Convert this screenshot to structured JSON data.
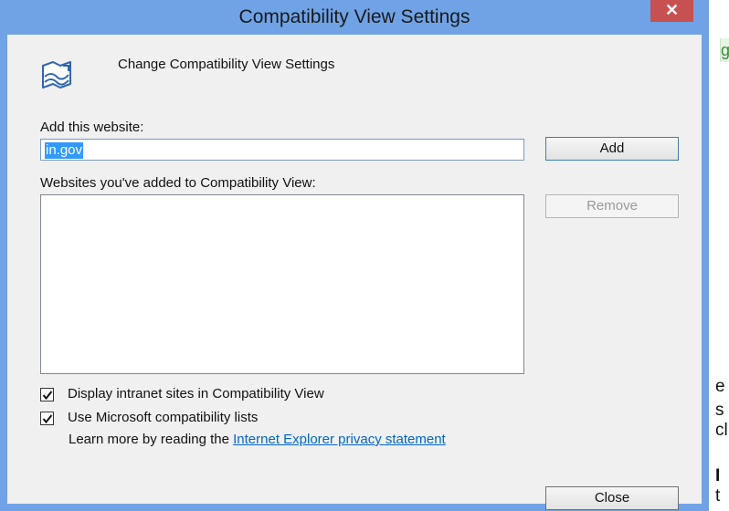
{
  "window": {
    "title": "Compatibility View Settings",
    "close_glyph": "✕",
    "title_bar_color": "#6fa3e6",
    "close_button_color": "#c75050"
  },
  "header": {
    "icon": "compatibility-view-icon",
    "text": "Change Compatibility View Settings"
  },
  "add_website": {
    "label": "Add this website:",
    "value": "in.gov",
    "button_label": "Add"
  },
  "websites_list": {
    "label": "Websites you've added to Compatibility View:",
    "items": [],
    "remove_label": "Remove"
  },
  "options": [
    {
      "label": "Display intranet sites in Compatibility View",
      "checked": true
    },
    {
      "label": "Use Microsoft compatibility lists",
      "checked": true
    }
  ],
  "learn_more": {
    "prefix": "Learn more by reading the ",
    "link": "Internet Explorer privacy statement"
  },
  "footer": {
    "close_label": "Close"
  },
  "background_fragments": {
    "green": "g",
    "lines": [
      "e",
      "s",
      "cl",
      "I",
      "t"
    ]
  }
}
